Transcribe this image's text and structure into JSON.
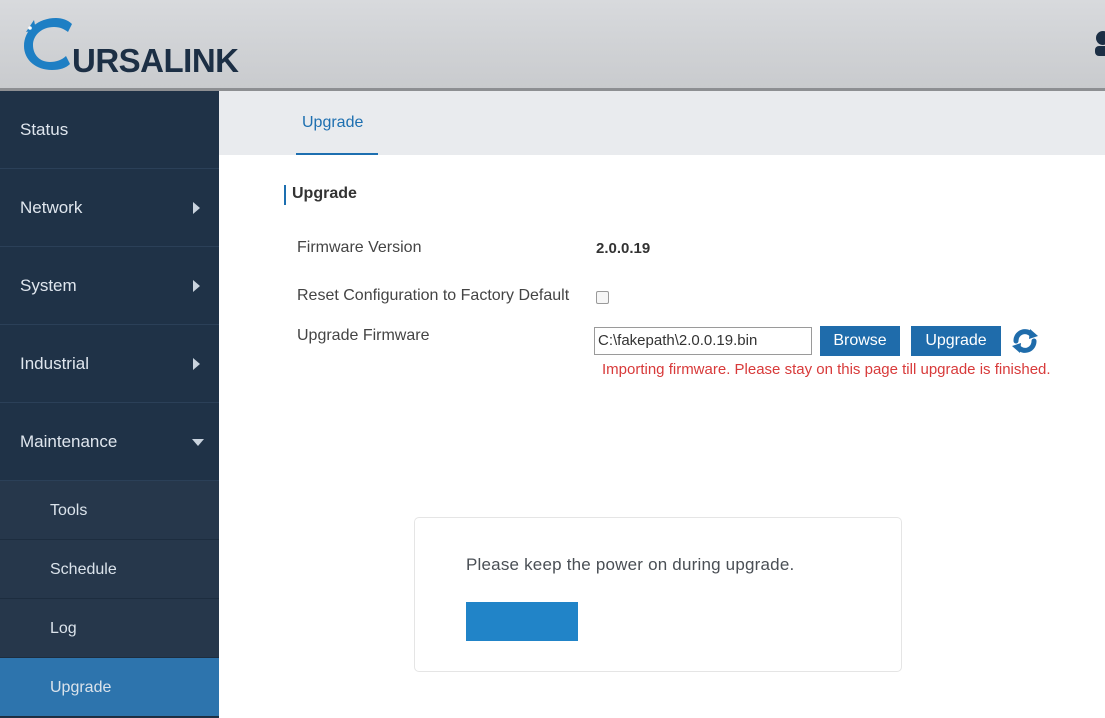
{
  "header": {
    "logo_text": "URSALINK",
    "logo_icon": "ursalink-bear-icon",
    "user_icon": "user-icon"
  },
  "sidebar": {
    "items": [
      {
        "label": "Status",
        "has_arrow": false
      },
      {
        "label": "Network",
        "has_arrow": true
      },
      {
        "label": "System",
        "has_arrow": true
      },
      {
        "label": "Industrial",
        "has_arrow": true
      },
      {
        "label": "Maintenance",
        "expanded": true
      }
    ],
    "sub_items": [
      {
        "label": "Tools"
      },
      {
        "label": "Schedule"
      },
      {
        "label": "Log"
      },
      {
        "label": "Upgrade",
        "active": true
      }
    ]
  },
  "tabs": [
    {
      "label": "Upgrade",
      "active": true
    }
  ],
  "section": {
    "title": "Upgrade"
  },
  "form": {
    "firmware_version_label": "Firmware Version",
    "firmware_version_value": "2.0.0.19",
    "reset_label": "Reset Configuration to Factory Default",
    "reset_checked": false,
    "upgrade_firmware_label": "Upgrade Firmware",
    "file_value": "C:\\fakepath\\2.0.0.19.bin",
    "browse_label": "Browse",
    "upgrade_label": "Upgrade",
    "refresh_icon": "refresh-icon",
    "error_message": "Importing firmware. Please stay on this page till upgrade is finished."
  },
  "modal": {
    "message": "Please keep the power on during upgrade.",
    "button_label": ""
  },
  "colors": {
    "sidebar_bg": "#1f3247",
    "accent": "#1d6fb0",
    "active_sub": "#2d74ad",
    "error": "#d83a3a",
    "modal_button": "#2184c8"
  }
}
